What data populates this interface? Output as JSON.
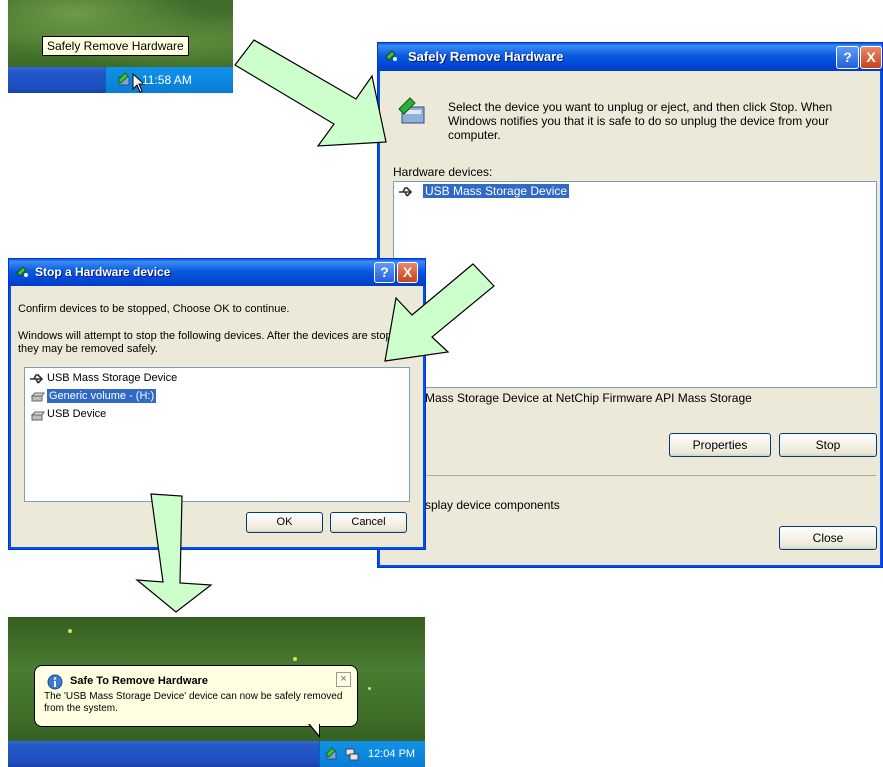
{
  "tray_snapshot": {
    "tooltip": "Safely Remove Hardware",
    "time": "11:58 AM"
  },
  "safely_remove_dialog": {
    "title": "Safely Remove Hardware",
    "instructions": "Select the device you want to unplug or eject, and then click Stop. When Windows notifies you that it is safe to do so unplug the device from your computer.",
    "devices_label": "Hardware devices:",
    "devices": [
      "USB Mass Storage Device"
    ],
    "device_description": "Mass Storage Device at NetChip Firmware API Mass Storage",
    "properties_button": "Properties",
    "stop_button": "Stop",
    "display_components_label": "splay device components",
    "close_button": "Close",
    "help_button": "?",
    "close_x": "X"
  },
  "stop_device_dialog": {
    "title": "Stop a Hardware device",
    "confirm_text": "Confirm devices to be stopped, Choose OK to continue.",
    "info_text": "Windows will attempt to stop the following devices. After the devices are stopped they may be removed safely.",
    "devices": [
      "USB Mass Storage Device",
      "Generic volume - (H:)",
      "USB Device"
    ],
    "ok_button": "OK",
    "cancel_button": "Cancel",
    "help_button": "?",
    "close_x": "X"
  },
  "balloon_snapshot": {
    "title": "Safe To Remove Hardware",
    "message": "The 'USB Mass Storage Device' device can now be safely removed from the system.",
    "time": "12:04 PM",
    "close_x": "×"
  },
  "colors": {
    "arrow_fill": "#ccffcc",
    "selection": "#316ac5",
    "title_blue": "#0054e3"
  }
}
